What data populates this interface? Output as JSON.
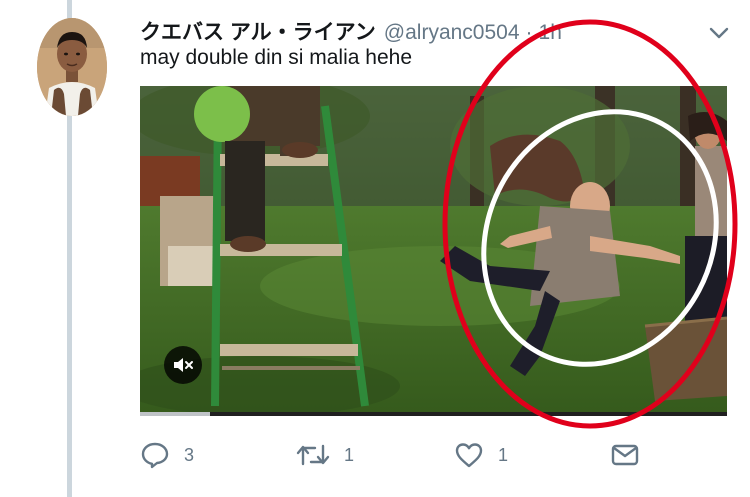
{
  "tweet": {
    "display_name": "クエバス アル・ライアン",
    "handle": "@alryanc0504",
    "separator": "·",
    "timestamp": "1h",
    "text": "may double din si malia hehe"
  },
  "media": {
    "type": "video",
    "muted": true,
    "progress": 0.12
  },
  "actions": {
    "reply": {
      "icon": "reply-icon",
      "count": "3"
    },
    "retweet": {
      "icon": "retweet-icon",
      "count": "1"
    },
    "like": {
      "icon": "heart-icon",
      "count": "1"
    },
    "message": {
      "icon": "envelope-icon"
    }
  },
  "icons": {
    "caret": "chevron-down-icon",
    "mute": "speaker-muted-icon"
  },
  "colors": {
    "text_primary": "#14171a",
    "text_secondary": "#657786",
    "thread_line": "#ccd6dd",
    "annotation_red": "#e0001b",
    "annotation_white": "#ffffff"
  }
}
